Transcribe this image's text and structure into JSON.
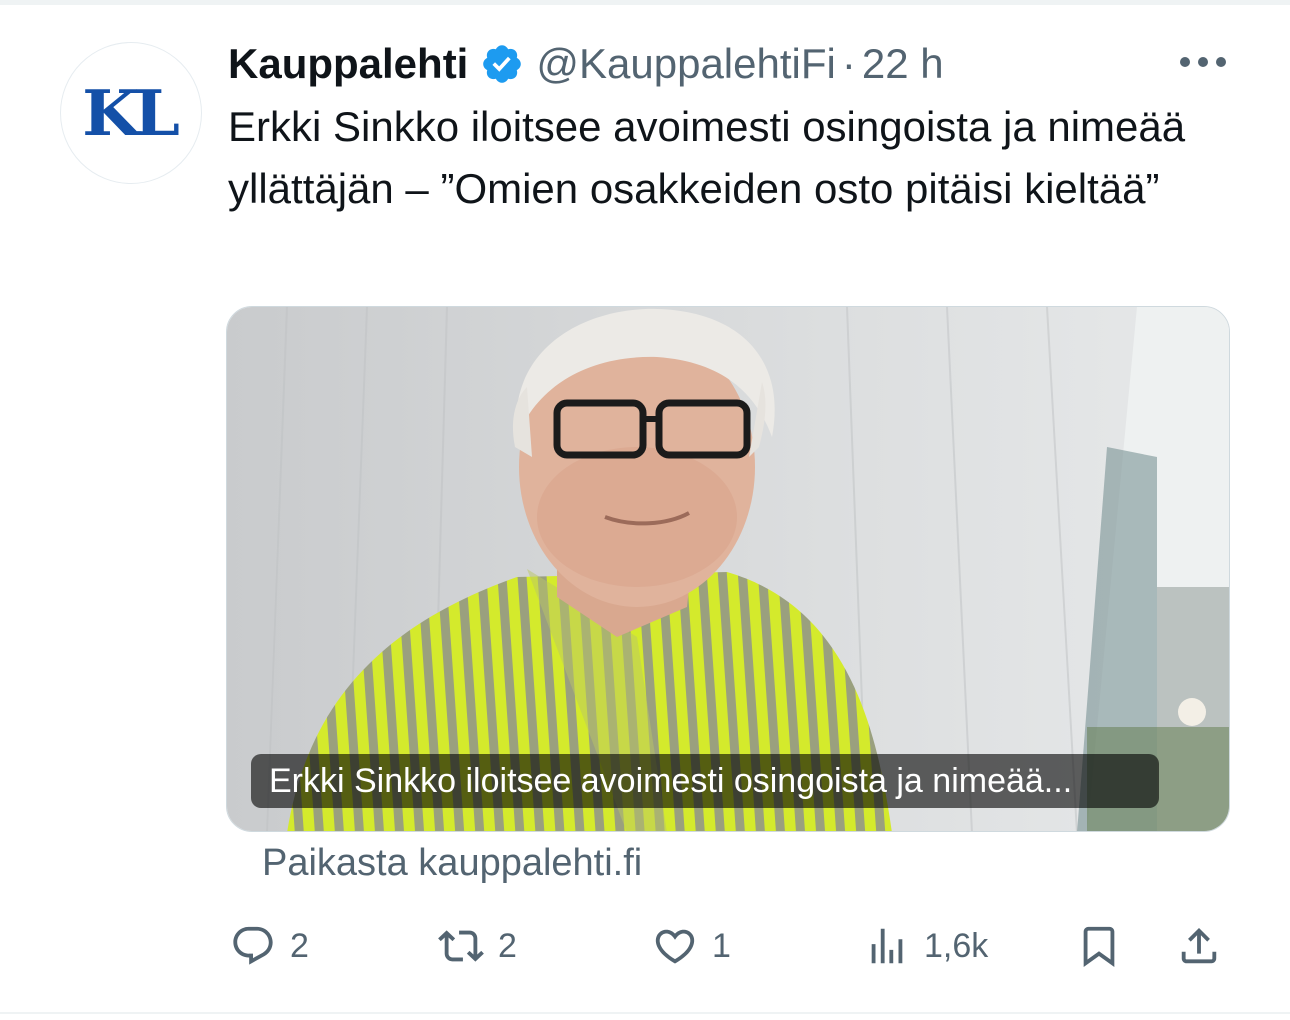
{
  "account": {
    "avatar_text": "KL",
    "display_name": "Kauppalehti",
    "handle": "@KauppalehtiFi",
    "separator": "·",
    "time": "22 h",
    "verified_icon": "verified-badge-icon"
  },
  "tweet": {
    "text": "Erkki Sinkko iloitsee avoimesti osingoista ja nimeää yllättäjän – ”Omien osakkeiden osto pitäisi kieltää”"
  },
  "card": {
    "caption": "Erkki Sinkko iloitsee avoimesti osingoista ja nimeää...",
    "source": "Paikasta kauppalehti.fi"
  },
  "actions": {
    "replies": "2",
    "retweets": "2",
    "likes": "1",
    "views": "1,6k"
  },
  "colors": {
    "text": "#0f1419",
    "secondary": "#536471",
    "verified": "#1d9bf0",
    "logo": "#1450a8"
  }
}
